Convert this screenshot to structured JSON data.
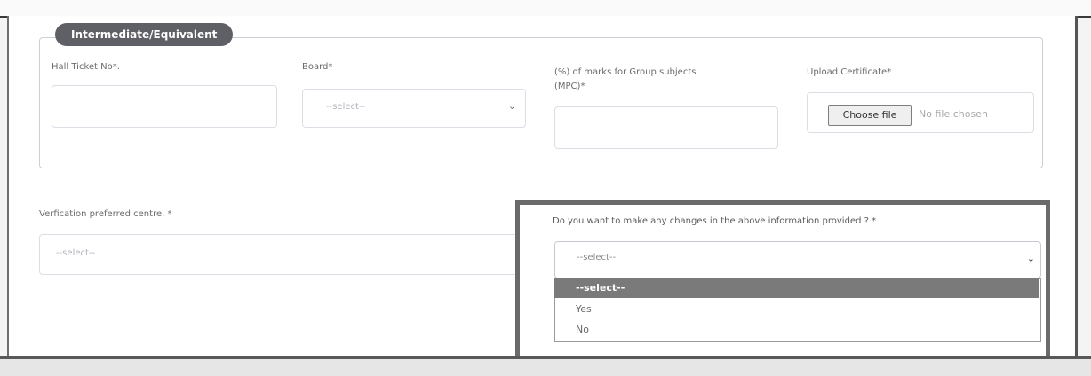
{
  "section": {
    "legend": "Intermediate/Equivalent"
  },
  "fields": {
    "hall_ticket_label": "Hall Ticket No*.",
    "board_label": "Board*",
    "board_placeholder": "--select--",
    "marks_label_line1": "(%) of marks for Group subjects",
    "marks_label_line2": "(MPC)*",
    "upload_label": "Upload Certificate*",
    "choose_file": "Choose file",
    "no_file": "No file chosen"
  },
  "verification": {
    "label": "Verfication preferred centre. *",
    "placeholder": "--select--"
  },
  "changes": {
    "label": "Do you want to make any changes in the above information provided ? *",
    "selected": "--select--",
    "options": [
      "--select--",
      "Yes",
      "No"
    ],
    "highlight_color": "#7a7a7a"
  }
}
